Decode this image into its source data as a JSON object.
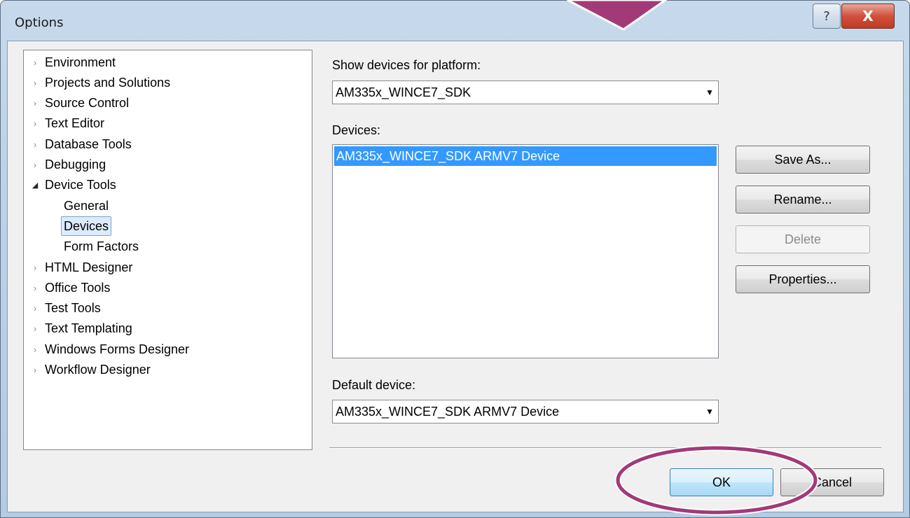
{
  "window": {
    "title": "Options",
    "help_glyph": "?",
    "close_glyph": "X"
  },
  "tree": {
    "items": [
      {
        "label": "Environment",
        "state": "collapsed"
      },
      {
        "label": "Projects and Solutions",
        "state": "collapsed"
      },
      {
        "label": "Source Control",
        "state": "collapsed"
      },
      {
        "label": "Text Editor",
        "state": "collapsed"
      },
      {
        "label": "Database Tools",
        "state": "collapsed"
      },
      {
        "label": "Debugging",
        "state": "collapsed"
      },
      {
        "label": "Device Tools",
        "state": "expanded"
      },
      {
        "label": "General",
        "state": "child"
      },
      {
        "label": "Devices",
        "state": "child-selected"
      },
      {
        "label": "Form Factors",
        "state": "child"
      },
      {
        "label": "HTML Designer",
        "state": "collapsed"
      },
      {
        "label": "Office Tools",
        "state": "collapsed"
      },
      {
        "label": "Test Tools",
        "state": "collapsed"
      },
      {
        "label": "Text Templating",
        "state": "collapsed"
      },
      {
        "label": "Windows Forms Designer",
        "state": "collapsed"
      },
      {
        "label": "Workflow Designer",
        "state": "collapsed"
      }
    ],
    "collapsed_glyph": "›",
    "expanded_glyph": "◢"
  },
  "platform": {
    "label": "Show devices for platform:",
    "value": "AM335x_WINCE7_SDK"
  },
  "devices": {
    "label": "Devices:",
    "items": [
      "AM335x_WINCE7_SDK ARMV7 Device"
    ],
    "selected_index": 0
  },
  "device_buttons": {
    "save_as": "Save As...",
    "rename": "Rename...",
    "delete": "Delete",
    "properties": "Properties..."
  },
  "default_device": {
    "label": "Default device:",
    "value": "AM335x_WINCE7_SDK ARMV7 Device"
  },
  "footer": {
    "ok": "OK",
    "cancel": "Cancel"
  },
  "colors": {
    "annotation": "#a23a78",
    "selection": "#3399ff"
  }
}
